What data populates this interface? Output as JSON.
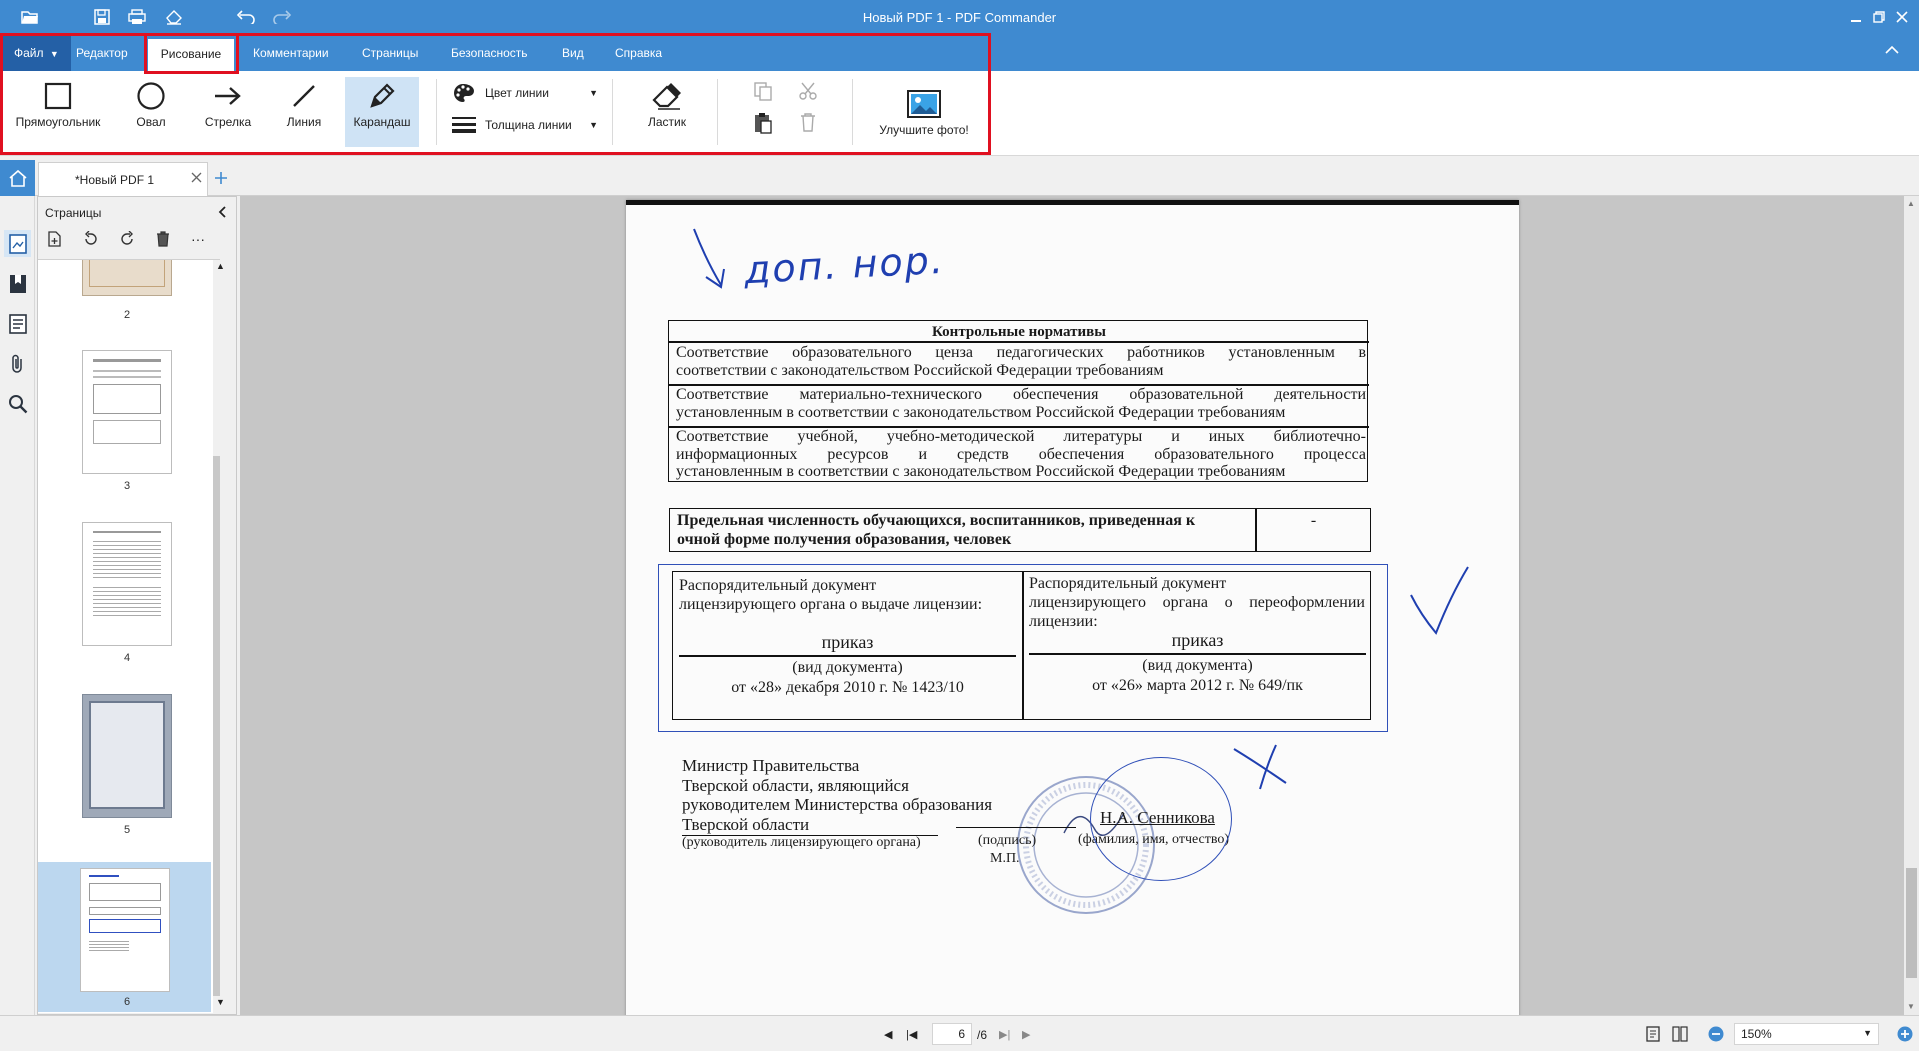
{
  "window": {
    "title": "Новый PDF 1 - PDF Commander"
  },
  "menu": {
    "file": "Файл",
    "editor": "Редактор",
    "drawing": "Рисование",
    "comments": "Комментарии",
    "pages": "Страницы",
    "security": "Безопасность",
    "view": "Вид",
    "help": "Справка"
  },
  "ribbon": {
    "rectangle": "Прямоугольник",
    "oval": "Овал",
    "arrow": "Стрелка",
    "line": "Линия",
    "pencil": "Карандаш",
    "line_color": "Цвет линии",
    "line_width": "Толщина линии",
    "eraser": "Ластик",
    "enhance_photo": "Улучшите фото!"
  },
  "tabs": {
    "document": "*Новый PDF 1"
  },
  "pages_panel": {
    "title": "Страницы",
    "thumbs": [
      "2",
      "3",
      "4",
      "5",
      "6"
    ]
  },
  "doc": {
    "handwritten_top": "доп. нор.",
    "table1_header": "Контрольные нормативы",
    "row1a": "Соответствие образовательного ценза педагогических работников установленным в",
    "row1b": "соответствии с законодательством Российской Федерации требованиям",
    "row2a": "Соответствие материально-технического обеспечения образовательной деятельности",
    "row2b": "установленным в соответствии с законодательством Российской Федерации требованиям",
    "row3a": "Соответствие учебной, учебно-методической литературы и иных библиотечно-",
    "row3b": "информационных ресурсов и средств обеспечения образовательного процесса",
    "row3c": "установленным в соответствии с законодательством Российской Федерации требованиям",
    "limit_a": "Предельная численность обучающихся, воспитанников, приведенная к",
    "limit_b": "очной форме получения образования, человек",
    "limit_value": "-",
    "lic_left_a": "Распорядительный документ",
    "lic_left_b": "лицензирующего органа о выдаче лицензии:",
    "lic_left_type": "приказ",
    "lic_left_caption": "(вид документа)",
    "lic_left_date": "от «28» декабря 2010 г. № 1423/10",
    "lic_right_a": "Распорядительный документ",
    "lic_right_b": "лицензирующего органа о переоформлении",
    "lic_right_c": "лицензии:",
    "lic_right_type": "приказ",
    "lic_right_caption": "(вид документа)",
    "lic_right_date": "от «26»  марта 2012 г. № 649/пк",
    "sign_1": "Министр Правительства",
    "sign_2": "Тверской области, являющийся",
    "sign_3": "руководителем Министерства образования",
    "sign_4": "Тверской области",
    "sign_5": "(руководитель лицензирующего органа)",
    "sign_sig": "(подпись)",
    "sign_mp": "М.П.",
    "sign_name": "Н.А. Сенникова",
    "sign_name_caption": "(фамилия, имя, отчество)"
  },
  "status": {
    "page_current": "6",
    "page_total": "/6",
    "zoom": "150%"
  },
  "colors": {
    "accent": "#3f8ad0",
    "file_menu": "#2460a6",
    "highlight": "#e01020",
    "ink": "#1f3fb0"
  }
}
